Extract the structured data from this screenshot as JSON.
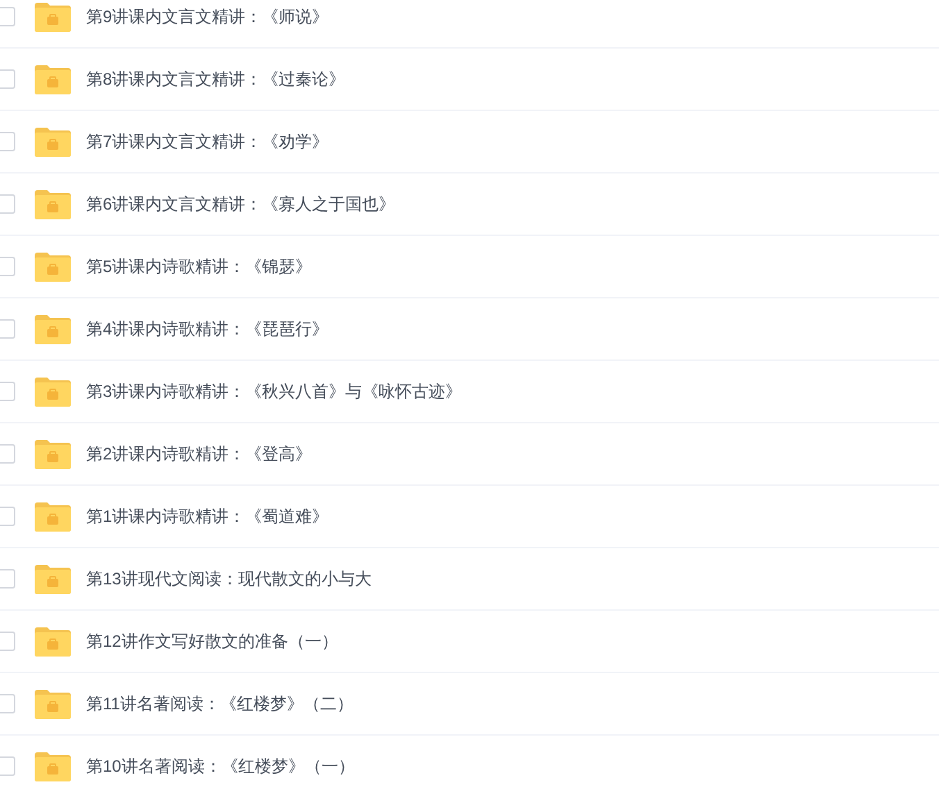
{
  "files": [
    {
      "name": "第9讲课内文言文精讲：《师说》",
      "checked": false
    },
    {
      "name": "第8讲课内文言文精讲：《过秦论》",
      "checked": false
    },
    {
      "name": "第7讲课内文言文精讲：《劝学》",
      "checked": false
    },
    {
      "name": "第6讲课内文言文精讲：《寡人之于国也》",
      "checked": false
    },
    {
      "name": "第5讲课内诗歌精讲：《锦瑟》",
      "checked": false
    },
    {
      "name": "第4讲课内诗歌精讲：《琵琶行》",
      "checked": false
    },
    {
      "name": "第3讲课内诗歌精讲：《秋兴八首》与《咏怀古迹》",
      "checked": false
    },
    {
      "name": "第2讲课内诗歌精讲：《登高》",
      "checked": false
    },
    {
      "name": "第1讲课内诗歌精讲：《蜀道难》",
      "checked": false
    },
    {
      "name": "第13讲现代文阅读：现代散文的小与大",
      "checked": false
    },
    {
      "name": "第12讲作文写好散文的准备（一）",
      "checked": false
    },
    {
      "name": "第11讲名著阅读：《红楼梦》（二）",
      "checked": false
    },
    {
      "name": "第10讲名著阅读：《红楼梦》（一）",
      "checked": false
    }
  ]
}
